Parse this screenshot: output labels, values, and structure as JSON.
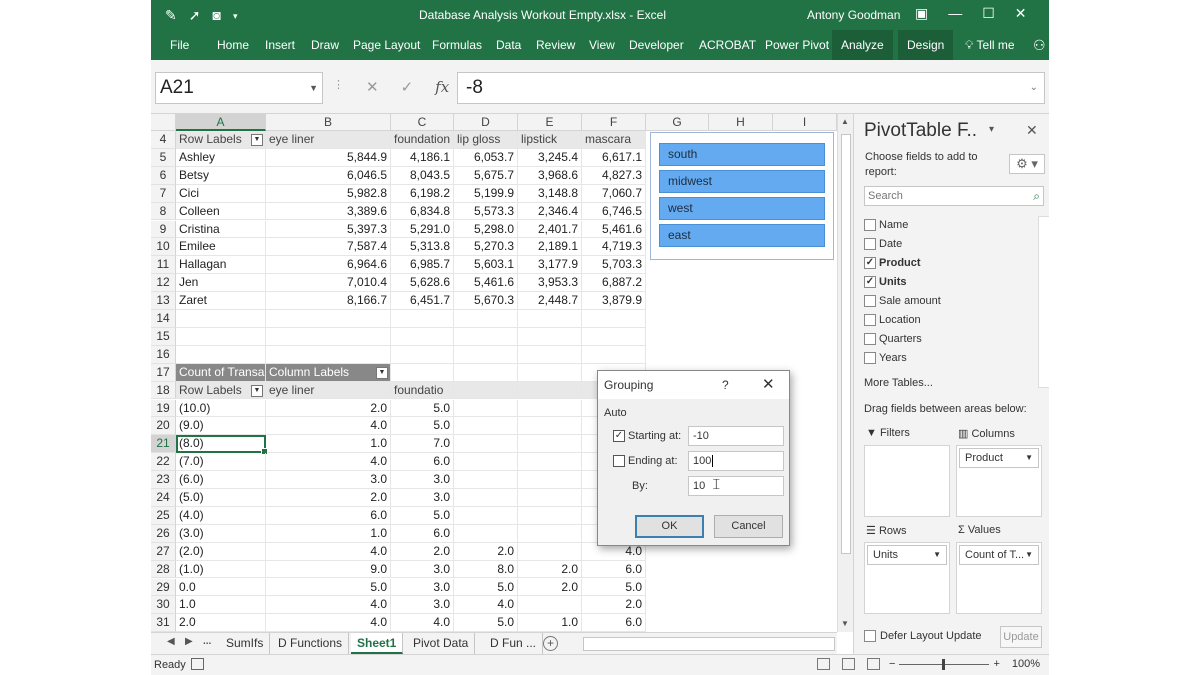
{
  "window": {
    "title": "Database Analysis Workout Empty.xlsx  -  Excel",
    "user": "Antony Goodman",
    "qat": [
      "pen-icon",
      "pointer-icon",
      "camera-icon",
      "customize-icon"
    ],
    "controls": [
      "ribbon-display-icon",
      "minimize-icon",
      "maximize-icon",
      "close-icon"
    ]
  },
  "ribbon": {
    "tabs": [
      "File",
      "Home",
      "Insert",
      "Draw",
      "Page Layout",
      "Formulas",
      "Data",
      "Review",
      "View",
      "Developer",
      "ACROBAT",
      "Power Pivot",
      "Analyze",
      "Design"
    ],
    "tell_me": "Tell me",
    "accent": "#217346"
  },
  "formula_bar": {
    "name_box": "A21",
    "cancel_icon": "✕",
    "enter_icon": "✓",
    "fx_label": "fx",
    "value": "-8"
  },
  "grid": {
    "columns": [
      "A",
      "B",
      "C",
      "D",
      "E",
      "F",
      "G",
      "H",
      "I"
    ],
    "rows": [
      {
        "num": "4",
        "cells": [
          "Row Labels",
          "eye liner",
          "foundation",
          "lip gloss",
          "lipstick",
          "mascara"
        ],
        "type": "header1"
      },
      {
        "num": "5",
        "cells": [
          "Ashley",
          "5,844.9",
          "4,186.1",
          "6,053.7",
          "3,245.4",
          "6,617.1"
        ]
      },
      {
        "num": "6",
        "cells": [
          "Betsy",
          "6,046.5",
          "8,043.5",
          "5,675.7",
          "3,968.6",
          "4,827.3"
        ]
      },
      {
        "num": "7",
        "cells": [
          "Cici",
          "5,982.8",
          "6,198.2",
          "5,199.9",
          "3,148.8",
          "7,060.7"
        ]
      },
      {
        "num": "8",
        "cells": [
          "Colleen",
          "3,389.6",
          "6,834.8",
          "5,573.3",
          "2,346.4",
          "6,746.5"
        ]
      },
      {
        "num": "9",
        "cells": [
          "Cristina",
          "5,397.3",
          "5,291.0",
          "5,298.0",
          "2,401.7",
          "5,461.6"
        ]
      },
      {
        "num": "10",
        "cells": [
          "Emilee",
          "7,587.4",
          "5,313.8",
          "5,270.3",
          "2,189.1",
          "4,719.3"
        ]
      },
      {
        "num": "11",
        "cells": [
          "Hallagan",
          "6,964.6",
          "6,985.7",
          "5,603.1",
          "3,177.9",
          "5,703.3"
        ]
      },
      {
        "num": "12",
        "cells": [
          "Jen",
          "7,010.4",
          "5,628.6",
          "5,461.6",
          "3,953.3",
          "6,887.2"
        ]
      },
      {
        "num": "13",
        "cells": [
          "Zaret",
          "8,166.7",
          "6,451.7",
          "5,670.3",
          "2,448.7",
          "3,879.9"
        ]
      },
      {
        "num": "14",
        "cells": [
          "",
          "",
          "",
          "",
          "",
          ""
        ]
      },
      {
        "num": "15",
        "cells": [
          "",
          "",
          "",
          "",
          "",
          ""
        ]
      },
      {
        "num": "16",
        "cells": [
          "",
          "",
          "",
          "",
          "",
          ""
        ]
      },
      {
        "num": "17",
        "cells": [
          "Count of Transa",
          "Column Labels",
          "",
          "",
          "",
          ""
        ],
        "type": "header2"
      },
      {
        "num": "18",
        "cells": [
          "Row Labels",
          "eye liner",
          "foundatio",
          "",
          "",
          ""
        ],
        "type": "header3"
      },
      {
        "num": "19",
        "cells": [
          "(10.0)",
          "2.0",
          "5.0",
          "",
          "",
          ""
        ]
      },
      {
        "num": "20",
        "cells": [
          "(9.0)",
          "4.0",
          "5.0",
          "",
          "",
          ""
        ]
      },
      {
        "num": "21",
        "cells": [
          "(8.0)",
          "1.0",
          "7.0",
          "",
          "",
          ""
        ],
        "selected": true
      },
      {
        "num": "22",
        "cells": [
          "(7.0)",
          "4.0",
          "6.0",
          "",
          "",
          ""
        ]
      },
      {
        "num": "23",
        "cells": [
          "(6.0)",
          "3.0",
          "3.0",
          "",
          "",
          ""
        ]
      },
      {
        "num": "24",
        "cells": [
          "(5.0)",
          "2.0",
          "3.0",
          "",
          "",
          ""
        ]
      },
      {
        "num": "25",
        "cells": [
          "(4.0)",
          "6.0",
          "5.0",
          "",
          "",
          ""
        ]
      },
      {
        "num": "26",
        "cells": [
          "(3.0)",
          "1.0",
          "6.0",
          "",
          "",
          ""
        ]
      },
      {
        "num": "27",
        "cells": [
          "(2.0)",
          "4.0",
          "2.0",
          "2.0",
          "",
          "4.0"
        ]
      },
      {
        "num": "28",
        "cells": [
          "(1.0)",
          "9.0",
          "3.0",
          "8.0",
          "2.0",
          "6.0"
        ]
      },
      {
        "num": "29",
        "cells": [
          "0.0",
          "5.0",
          "3.0",
          "5.0",
          "2.0",
          "5.0"
        ]
      },
      {
        "num": "30",
        "cells": [
          "1.0",
          "4.0",
          "3.0",
          "4.0",
          "",
          "2.0"
        ]
      },
      {
        "num": "31",
        "cells": [
          "2.0",
          "4.0",
          "4.0",
          "5.0",
          "1.0",
          "6.0"
        ]
      }
    ]
  },
  "slicer": {
    "items": [
      "south",
      "midwest",
      "west",
      "east"
    ],
    "color": "#63aaf0"
  },
  "sheet_tabs": {
    "nav": [
      "◀",
      "▶",
      "..."
    ],
    "tabs": [
      "SumIfs",
      "D Functions",
      "Sheet1",
      "Pivot Data",
      "D Fun ..."
    ],
    "active": "Sheet1"
  },
  "status": {
    "ready": "Ready",
    "zoom": "100%",
    "minus": "−",
    "plus": "+"
  },
  "pivot_pane": {
    "title": "PivotTable F..",
    "choose_text": "Choose fields to add to report:",
    "search_placeholder": "Search",
    "fields": [
      {
        "name": "Name",
        "checked": false
      },
      {
        "name": "Date",
        "checked": false
      },
      {
        "name": "Product",
        "checked": true
      },
      {
        "name": "Units",
        "checked": true
      },
      {
        "name": "Sale amount",
        "checked": false
      },
      {
        "name": "Location",
        "checked": false
      },
      {
        "name": "Quarters",
        "checked": false
      },
      {
        "name": "Years",
        "checked": false
      }
    ],
    "more_tables": "More Tables...",
    "drag_text": "Drag fields between areas below:",
    "areas": {
      "filters": "Filters",
      "columns": "Columns",
      "rows": "Rows",
      "values": "Values",
      "columns_item": "Product",
      "rows_item": "Units",
      "values_item": "Count of T..."
    },
    "defer": "Defer Layout Update",
    "update": "Update"
  },
  "dialog": {
    "title": "Grouping",
    "help": "?",
    "close": "✕",
    "auto": "Auto",
    "starting_label": "Starting at:",
    "starting_value": "-10",
    "starting_checked": true,
    "ending_label": "Ending at:",
    "ending_value": "100",
    "ending_checked": false,
    "by_label": "By:",
    "by_value": "10",
    "ok": "OK",
    "cancel": "Cancel"
  }
}
